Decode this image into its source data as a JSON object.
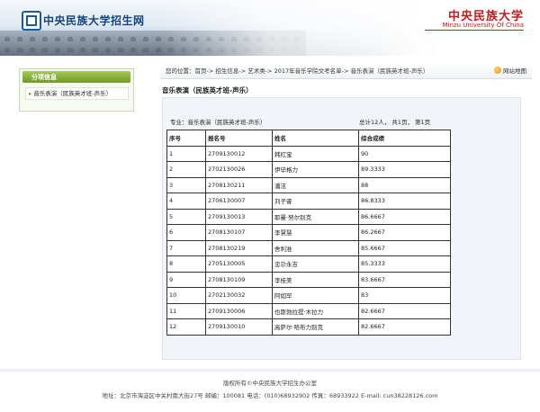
{
  "header": {
    "site_title": "中央民族大学招生网",
    "university_cn": "中央民族大学",
    "university_en": "Minzu University Of China"
  },
  "sidebar": {
    "heading": "分项信息",
    "items": [
      {
        "label": "音乐表演（民族英才班-声乐）"
      }
    ]
  },
  "breadcrumb": {
    "text": "您的位置：首页-> 招生信息-> 艺术类-> 2017年音乐学院文考名单-> 音乐表演（民族英才班-声乐）",
    "site_map": "网站地图"
  },
  "main": {
    "title": "音乐表演（民族英才班-声乐）",
    "major_label": "专业：音乐表演（民族英才班-声乐）",
    "summary": "总计12人， 共1页， 第1页"
  },
  "table": {
    "headers": [
      "序号",
      "报名号",
      "姓名",
      "综合成绩"
    ],
    "rows": [
      [
        "1",
        "2709130012",
        "韩红宝",
        "90"
      ],
      [
        "2",
        "2702130026",
        "伊毕格力",
        "89.3333"
      ],
      [
        "3",
        "2708130211",
        "潘洁",
        "88"
      ],
      [
        "4",
        "2706130007",
        "刘子睿",
        "86.8333"
      ],
      [
        "5",
        "2709130013",
        "耶曼·努尔别克",
        "86.6667"
      ],
      [
        "6",
        "2708130107",
        "李慧慧",
        "86.2667"
      ],
      [
        "7",
        "2708130219",
        "舍利准",
        "85.6667"
      ],
      [
        "8",
        "2705130005",
        "忠尕永吉",
        "85.3333"
      ],
      [
        "9",
        "2708130109",
        "李桂美",
        "83.6667"
      ],
      [
        "10",
        "2702130032",
        "阿如罕",
        "83"
      ],
      [
        "11",
        "2709130006",
        "也斯勃拉提·木拉力",
        "82.6667"
      ],
      [
        "12",
        "2709130010",
        "高萨尔·哈布力别克",
        "82.6667"
      ]
    ]
  },
  "footer": {
    "copyright": "版权所有©中央民族大学招生办公室",
    "contact": "地址：北京市海淀区中关村南大街27号 邮编：100081 电话：(010)68932902 传真：68933922 E-mail: cun38228126.com"
  }
}
